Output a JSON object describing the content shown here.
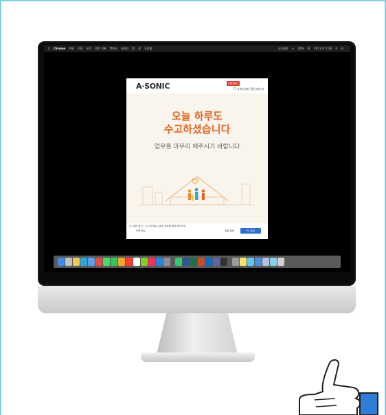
{
  "menubar": {
    "app": "Chrome",
    "items": [
      "파일",
      "수정",
      "보기",
      "방문 기록",
      "북마크",
      "사용자",
      "탭",
      "창",
      "도움말"
    ],
    "status": [
      "근무관리",
      "30%",
      "Kr",
      "(목) 오후 5:28"
    ]
  },
  "dialog": {
    "logo": "A·SONIC",
    "badge": "ASONIC",
    "subtitle": "IT 서비스센터 알림 메시지",
    "heading_line1": "오늘 하루도",
    "heading_line2": "수고하셨습니다",
    "message": "업무를 마무리 해주시기 바랍니다",
    "notice": "PC 알림 확인 | 시스템 종료 | 알림 종료를 클릭 해주세요",
    "option_label": "전원 종료",
    "cancel_label": "알림 해제",
    "ok_label": "PC 종료"
  },
  "colors": {
    "accent": "#e8631f",
    "button": "#2f6fd0",
    "frame_border": "#7fcfe0",
    "thumb_accent": "#2f7dd6"
  },
  "dock_icons": [
    "finder-icon",
    "launchpad-icon",
    "notes-icon",
    "safari-icon",
    "mail-icon",
    "chrome-icon",
    "messages-icon",
    "facetime-icon",
    "photos-icon",
    "calendar-icon",
    "reminders-icon",
    "maps-icon",
    "music-icon",
    "app-store-icon",
    "settings-icon",
    "whale-icon",
    "word-icon",
    "excel-icon",
    "powerpoint-icon",
    "outlook-icon",
    "teams-icon",
    "terminal-icon",
    "preview-icon",
    "notepad-icon",
    "folder-icon",
    "downloads-icon",
    "documents-icon",
    "desktop-icon",
    "trash-icon"
  ]
}
